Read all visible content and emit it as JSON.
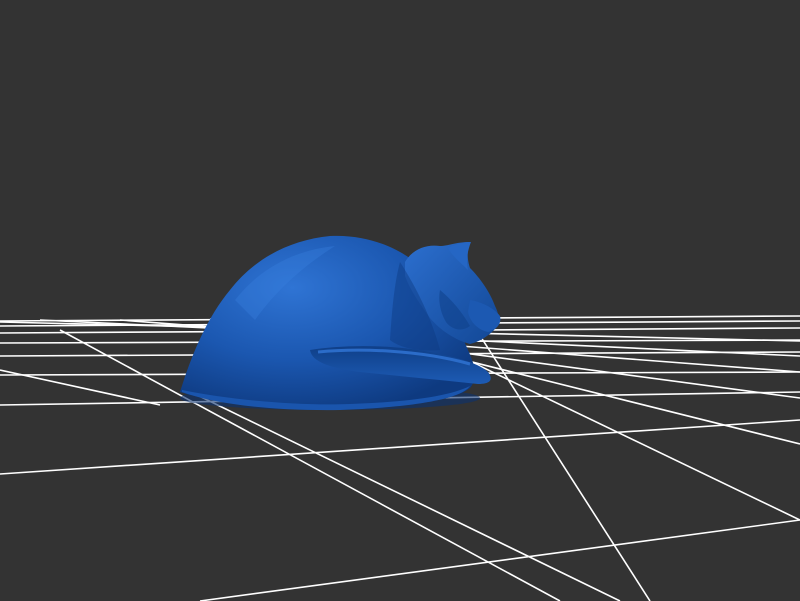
{
  "viewer": {
    "background_color": "#333333",
    "grid_color": "#ffffff",
    "model_color": "#1f5fb8",
    "model_shadow_color": "#0f3a7a",
    "model_highlight_color": "#2f78d6"
  }
}
